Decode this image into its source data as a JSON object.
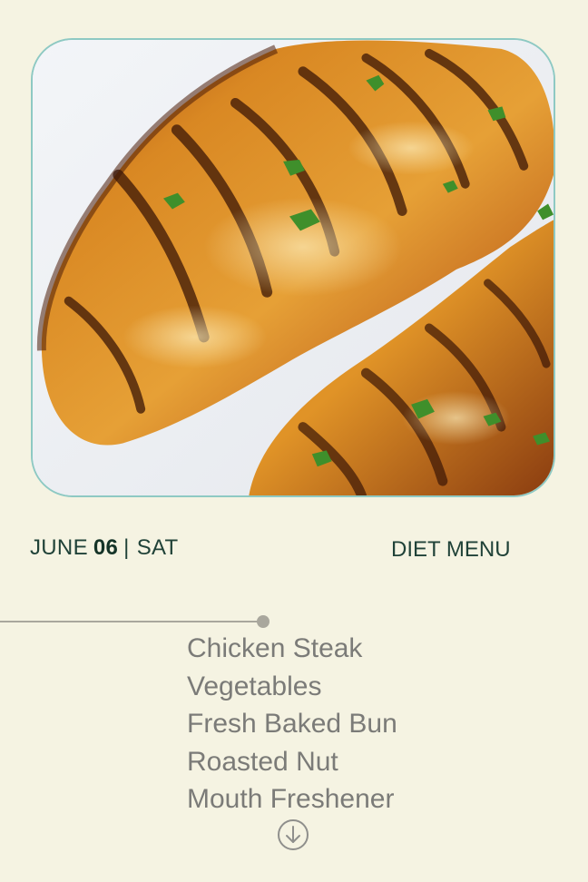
{
  "hero": {
    "image_subject": "grilled-chicken-steak-photo"
  },
  "date": {
    "month": "JUNE",
    "day": "06",
    "separator": "|",
    "weekday": "SAT"
  },
  "menu": {
    "title": "DIET MENU",
    "items": [
      "Chicken Steak",
      "Vegetables",
      "Fresh Baked Bun",
      "Roasted Nut",
      "Mouth Freshener"
    ]
  },
  "controls": {
    "scroll_icon": "arrow-down-circle-icon"
  },
  "colors": {
    "background": "#f5f3e2",
    "accent_border": "#8ec9c3",
    "heading_text": "#204238",
    "list_text": "#7b7b78",
    "line": "#a9a79d"
  }
}
